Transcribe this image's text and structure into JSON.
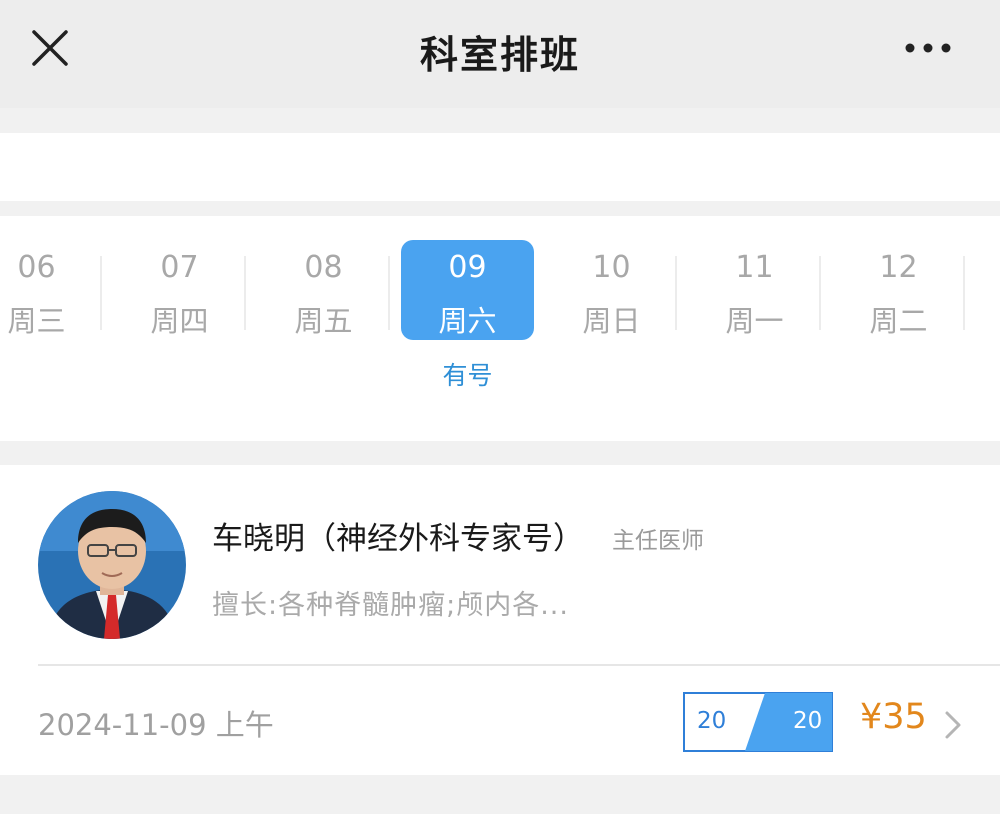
{
  "nav": {
    "title": "科室排班",
    "close_icon": "close-icon",
    "more_icon": "more-horizontal-icon"
  },
  "dates": [
    {
      "day": "06",
      "week": "周三",
      "selected": false
    },
    {
      "day": "07",
      "week": "周四",
      "selected": false
    },
    {
      "day": "08",
      "week": "周五",
      "selected": false
    },
    {
      "day": "09",
      "week": "周六",
      "selected": true,
      "status": "有号"
    },
    {
      "day": "10",
      "week": "周日",
      "selected": false
    },
    {
      "day": "11",
      "week": "周一",
      "selected": false
    },
    {
      "day": "12",
      "week": "周二",
      "selected": false
    }
  ],
  "doctor": {
    "name": "车晓明（神经外科专家号）",
    "title": "主任医师",
    "skill": "擅长:各种脊髓肿瘤;颅内各...",
    "slot_date": "2024-11-09 上午",
    "remaining": "20",
    "total": "20",
    "price": "¥35"
  },
  "colors": {
    "accent": "#4aa3f0",
    "accent_text": "#2f8fd6",
    "price": "#e2871c",
    "quota_border": "#2f7fd8"
  }
}
